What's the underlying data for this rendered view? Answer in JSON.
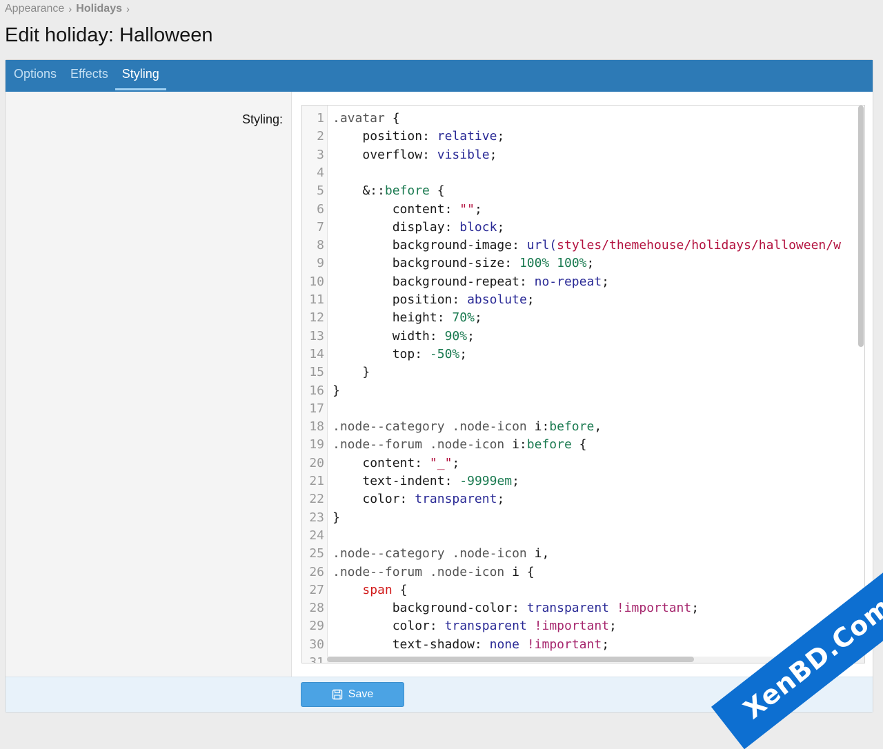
{
  "breadcrumb": {
    "items": [
      "Appearance",
      "Holidays"
    ],
    "separator": "›"
  },
  "page": {
    "title": "Edit holiday: Halloween"
  },
  "tabs": [
    {
      "label": "Options",
      "active": false
    },
    {
      "label": "Effects",
      "active": false
    },
    {
      "label": "Styling",
      "active": true
    }
  ],
  "form": {
    "styling_label": "Styling:"
  },
  "editor": {
    "lines": [
      [
        [
          "sel",
          ".avatar"
        ],
        [
          "plain",
          " {"
        ]
      ],
      [
        [
          "plain",
          "    "
        ],
        [
          "prop",
          "position"
        ],
        [
          "plain",
          ": "
        ],
        [
          "val",
          "relative"
        ],
        [
          "plain",
          ";"
        ]
      ],
      [
        [
          "plain",
          "    "
        ],
        [
          "prop",
          "overflow"
        ],
        [
          "plain",
          ": "
        ],
        [
          "val",
          "visible"
        ],
        [
          "plain",
          ";"
        ]
      ],
      [
        [
          "plain",
          ""
        ]
      ],
      [
        [
          "plain",
          "    &::"
        ],
        [
          "pseudo",
          "before"
        ],
        [
          "plain",
          " {"
        ]
      ],
      [
        [
          "plain",
          "        "
        ],
        [
          "prop",
          "content"
        ],
        [
          "plain",
          ": "
        ],
        [
          "str",
          "\"\""
        ],
        [
          "plain",
          ";"
        ]
      ],
      [
        [
          "plain",
          "        "
        ],
        [
          "prop",
          "display"
        ],
        [
          "plain",
          ": "
        ],
        [
          "val",
          "block"
        ],
        [
          "plain",
          ";"
        ]
      ],
      [
        [
          "plain",
          "        "
        ],
        [
          "prop",
          "background-image"
        ],
        [
          "plain",
          ": "
        ],
        [
          "val",
          "url("
        ],
        [
          "str",
          "styles/themehouse/holidays/halloween/w"
        ]
      ],
      [
        [
          "plain",
          "        "
        ],
        [
          "prop",
          "background-size"
        ],
        [
          "plain",
          ": "
        ],
        [
          "num",
          "100%"
        ],
        [
          "plain",
          " "
        ],
        [
          "num",
          "100%"
        ],
        [
          "plain",
          ";"
        ]
      ],
      [
        [
          "plain",
          "        "
        ],
        [
          "prop",
          "background-repeat"
        ],
        [
          "plain",
          ": "
        ],
        [
          "val",
          "no-repeat"
        ],
        [
          "plain",
          ";"
        ]
      ],
      [
        [
          "plain",
          "        "
        ],
        [
          "prop",
          "position"
        ],
        [
          "plain",
          ": "
        ],
        [
          "val",
          "absolute"
        ],
        [
          "plain",
          ";"
        ]
      ],
      [
        [
          "plain",
          "        "
        ],
        [
          "prop",
          "height"
        ],
        [
          "plain",
          ": "
        ],
        [
          "num",
          "70%"
        ],
        [
          "plain",
          ";"
        ]
      ],
      [
        [
          "plain",
          "        "
        ],
        [
          "prop",
          "width"
        ],
        [
          "plain",
          ": "
        ],
        [
          "num",
          "90%"
        ],
        [
          "plain",
          ";"
        ]
      ],
      [
        [
          "plain",
          "        "
        ],
        [
          "prop",
          "top"
        ],
        [
          "plain",
          ": "
        ],
        [
          "num",
          "-50%"
        ],
        [
          "plain",
          ";"
        ]
      ],
      [
        [
          "plain",
          "    }"
        ]
      ],
      [
        [
          "plain",
          "}"
        ]
      ],
      [
        [
          "plain",
          ""
        ]
      ],
      [
        [
          "sel",
          ".node--category .node-icon "
        ],
        [
          "plain",
          "i:"
        ],
        [
          "pseudo",
          "before"
        ],
        [
          "plain",
          ","
        ]
      ],
      [
        [
          "sel",
          ".node--forum .node-icon "
        ],
        [
          "plain",
          "i:"
        ],
        [
          "pseudo",
          "before"
        ],
        [
          "plain",
          " {"
        ]
      ],
      [
        [
          "plain",
          "    "
        ],
        [
          "prop",
          "content"
        ],
        [
          "plain",
          ": "
        ],
        [
          "str",
          "\"_\""
        ],
        [
          "plain",
          ";"
        ]
      ],
      [
        [
          "plain",
          "    "
        ],
        [
          "prop",
          "text-indent"
        ],
        [
          "plain",
          ": "
        ],
        [
          "num",
          "-9999em"
        ],
        [
          "plain",
          ";"
        ]
      ],
      [
        [
          "plain",
          "    "
        ],
        [
          "prop",
          "color"
        ],
        [
          "plain",
          ": "
        ],
        [
          "val",
          "transparent"
        ],
        [
          "plain",
          ";"
        ]
      ],
      [
        [
          "plain",
          "}"
        ]
      ],
      [
        [
          "plain",
          ""
        ]
      ],
      [
        [
          "sel",
          ".node--category .node-icon "
        ],
        [
          "plain",
          "i,"
        ]
      ],
      [
        [
          "sel",
          ".node--forum .node-icon "
        ],
        [
          "plain",
          "i {"
        ]
      ],
      [
        [
          "plain",
          "    "
        ],
        [
          "tag",
          "span"
        ],
        [
          "plain",
          " {"
        ]
      ],
      [
        [
          "plain",
          "        "
        ],
        [
          "prop",
          "background-color"
        ],
        [
          "plain",
          ": "
        ],
        [
          "val",
          "transparent"
        ],
        [
          "plain",
          " "
        ],
        [
          "kw",
          "!important"
        ],
        [
          "plain",
          ";"
        ]
      ],
      [
        [
          "plain",
          "        "
        ],
        [
          "prop",
          "color"
        ],
        [
          "plain",
          ": "
        ],
        [
          "val",
          "transparent"
        ],
        [
          "plain",
          " "
        ],
        [
          "kw",
          "!important"
        ],
        [
          "plain",
          ";"
        ]
      ],
      [
        [
          "plain",
          "        "
        ],
        [
          "prop",
          "text-shadow"
        ],
        [
          "plain",
          ": "
        ],
        [
          "val",
          "none"
        ],
        [
          "plain",
          " "
        ],
        [
          "kw",
          "!important"
        ],
        [
          "plain",
          ";"
        ]
      ],
      [
        [
          "plain",
          ""
        ]
      ]
    ]
  },
  "footer": {
    "save_label": "Save"
  },
  "watermark": {
    "text": "XenBD.Com"
  },
  "colors": {
    "tabbar": "#2d7ab6",
    "save_button": "#4ba3e4",
    "watermark": "#0d6fd1"
  }
}
